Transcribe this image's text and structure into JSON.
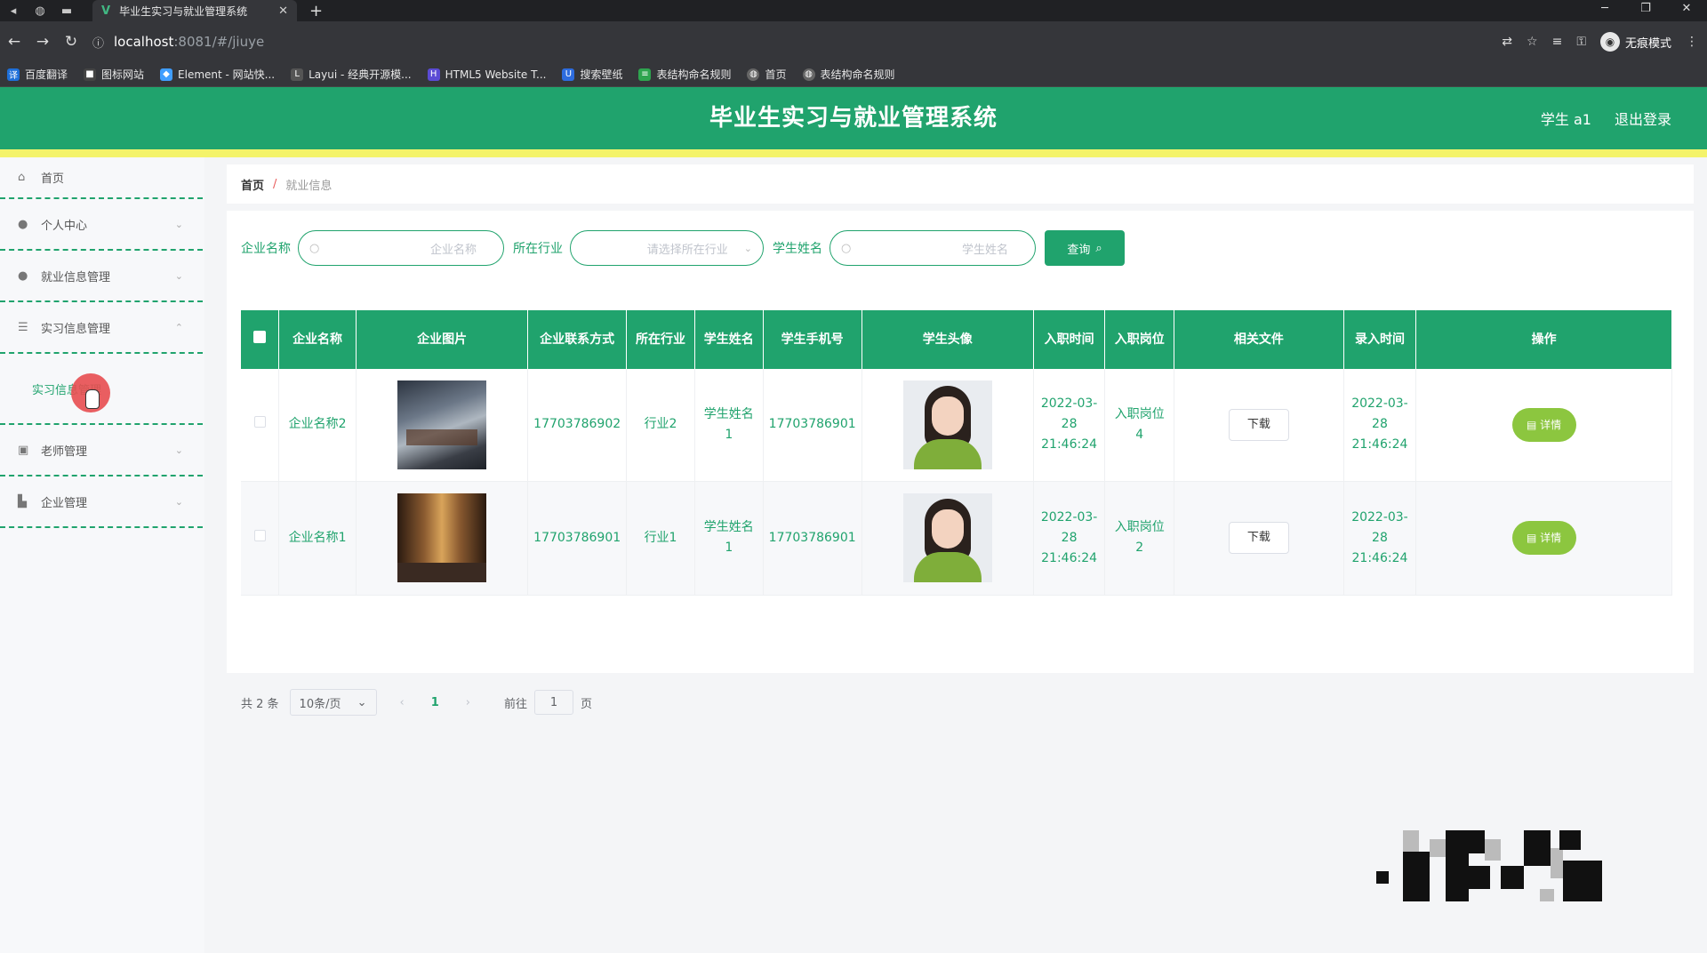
{
  "browser": {
    "tab_title": "毕业生实习与就业管理系统",
    "tab_favicon": "V",
    "url_host": "localhost",
    "url_path": ":8081/#/jiuye",
    "incognito_label": "无痕模式",
    "bookmarks": [
      {
        "icon_color": "#1e6fd9",
        "label": "百度翻译"
      },
      {
        "icon_color": "#444444",
        "label": "图标网站"
      },
      {
        "icon_color": "#409eff",
        "label": "Element - 网站快..."
      },
      {
        "icon_color": "#555555",
        "label": "Layui - 经典开源模..."
      },
      {
        "icon_color": "#5b4bd5",
        "label": "HTML5 Website T..."
      },
      {
        "icon_color": "#2d6cdf",
        "label": "搜索壁纸"
      },
      {
        "icon_color": "#2ea44f",
        "label": "表结构命名规则"
      },
      {
        "icon_color": "#666666",
        "label": "首页"
      },
      {
        "icon_color": "#666666",
        "label": "表结构命名规则"
      }
    ]
  },
  "header": {
    "title": "毕业生实习与就业管理系统",
    "user": "学生 a1",
    "logout": "退出登录",
    "brand_color": "#20a36d"
  },
  "sidebar": {
    "items": [
      {
        "label": "首页"
      },
      {
        "label": "个人中心"
      },
      {
        "label": "就业信息管理"
      },
      {
        "label": "实习信息管理"
      },
      {
        "label": "老师管理"
      },
      {
        "label": "企业管理"
      }
    ],
    "sub_item": "实习信息管理"
  },
  "breadcrumb": {
    "home": "首页",
    "separator": "/",
    "current": "就业信息"
  },
  "search": {
    "company_label": "企业名称",
    "company_placeholder": "企业名称",
    "industry_label": "所在行业",
    "industry_placeholder": "请选择所在行业",
    "student_label": "学生姓名",
    "student_placeholder": "学生姓名",
    "query_button": "查询"
  },
  "table": {
    "headers": [
      "企业名称",
      "企业图片",
      "企业联系方式",
      "所在行业",
      "学生姓名",
      "学生手机号",
      "学生头像",
      "入职时间",
      "入职岗位",
      "相关文件",
      "录入时间",
      "操作"
    ],
    "rows": [
      {
        "company": "企业名称2",
        "phone": "17703786902",
        "industry": "行业2",
        "student": "学生姓名1",
        "student_phone": "17703786901",
        "entry_time": "2022-03-28 21:46:24",
        "position": "入职岗位4",
        "file_button": "下载",
        "record_time": "2022-03-28 21:46:24",
        "detail_button": "详情"
      },
      {
        "company": "企业名称1",
        "phone": "17703786901",
        "industry": "行业1",
        "student": "学生姓名1",
        "student_phone": "17703786901",
        "entry_time": "2022-03-28 21:46:24",
        "position": "入职岗位2",
        "file_button": "下载",
        "record_time": "2022-03-28 21:46:24",
        "detail_button": "详情"
      }
    ]
  },
  "pagination": {
    "total": "共 2 条",
    "page_size": "10条/页",
    "current_page": "1",
    "goto_label": "前往",
    "goto_value": "1",
    "page_suffix": "页"
  }
}
